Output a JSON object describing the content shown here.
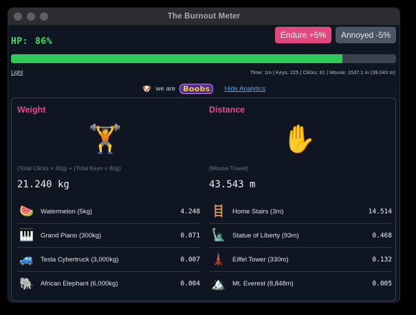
{
  "window": {
    "title": "The Burnout Meter"
  },
  "hp": {
    "label": "HP:",
    "value": "86%",
    "level": 0.86
  },
  "buttons": {
    "endure": "Endure +5%",
    "annoyed": "Annoyed -5%"
  },
  "links": {
    "light": "Light",
    "hide_analytics": "Hide Analytics"
  },
  "stats": "Time: 1m | Keys: 225 | Clicks: 81 | Mouse: 1537.1 in (39.043 m)",
  "brand": {
    "prefix": "we are",
    "logo_text": "Boobs"
  },
  "weight": {
    "heading": "Weight",
    "hero_icon": "weightlifter-icon",
    "formula": "(Total Clicks × 40g) + (Total Keys × 80g)",
    "total": "21.240 kg",
    "rows": [
      {
        "icon": "watermelon-icon",
        "label": "Watermelon (5kg)",
        "value": "4.248"
      },
      {
        "icon": "piano-icon",
        "label": "Grand Piano (300kg)",
        "value": "0.071"
      },
      {
        "icon": "car-icon",
        "label": "Tesla Cybertruck (3,000kg)",
        "value": "0.007"
      },
      {
        "icon": "elephant-icon",
        "label": "African Elephant (6,000kg)",
        "value": "0.004"
      }
    ]
  },
  "distance": {
    "heading": "Distance",
    "hero_icon": "hand-icon",
    "formula": "(Mouse Travel)",
    "total": "43.543 m",
    "rows": [
      {
        "icon": "stairs-icon",
        "label": "Home Stairs (3m)",
        "value": "14.514"
      },
      {
        "icon": "statue-of-liberty-icon",
        "label": "Statue of Liberty (93m)",
        "value": "0.468"
      },
      {
        "icon": "eiffel-tower-icon",
        "label": "Eiffel Tower (330m)",
        "value": "0.132"
      },
      {
        "icon": "mountain-icon",
        "label": "Mt. Everest (8,848m)",
        "value": "0.005"
      }
    ]
  }
}
